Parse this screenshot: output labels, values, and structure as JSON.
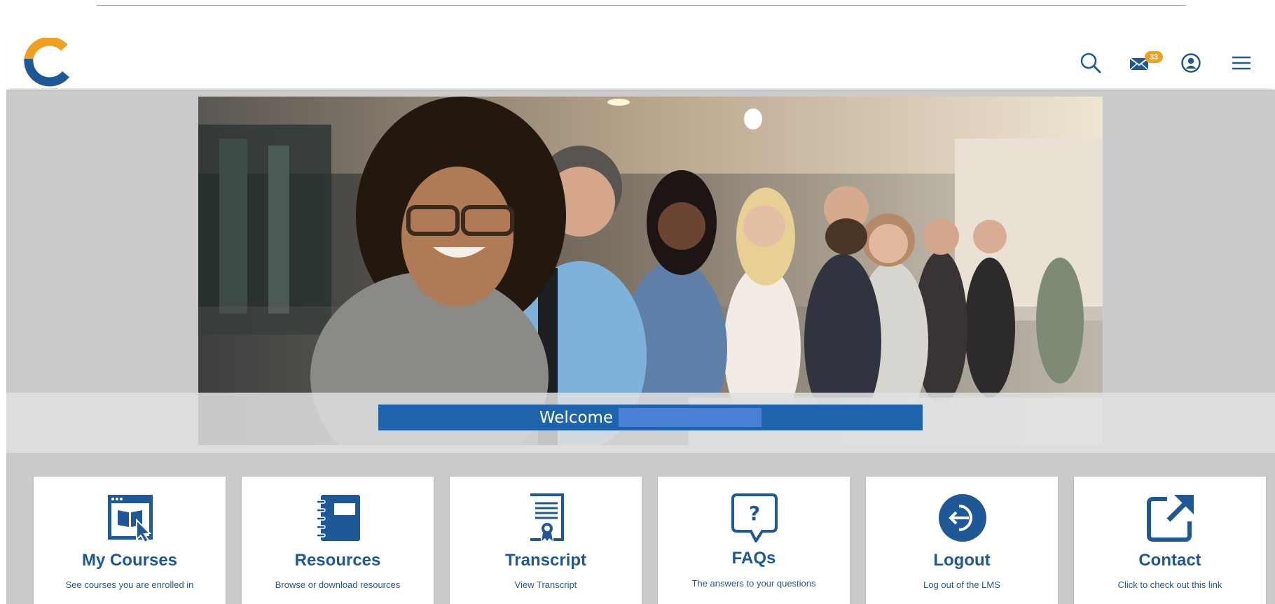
{
  "header": {
    "logo_name": "c-logo",
    "search_icon": "search-icon",
    "mail_icon": "mail-icon",
    "mail_badge": "33",
    "user_icon": "user-circle-icon",
    "menu_icon": "hamburger-menu-icon"
  },
  "hero": {
    "image": "group of smiling business people photo",
    "welcome": "Welcome"
  },
  "tiles": [
    {
      "title": "My Courses",
      "subtitle": "See courses you are enrolled in",
      "icon": "courses-icon"
    },
    {
      "title": "Resources",
      "subtitle": "Browse or download resources",
      "icon": "notebook-icon"
    },
    {
      "title": "Transcript",
      "subtitle": "View Transcript",
      "icon": "certificate-icon"
    },
    {
      "title": "FAQs",
      "subtitle": "The answers to your questions",
      "icon": "question-bubble-icon"
    },
    {
      "title": "Logout",
      "subtitle": "Log out of the LMS",
      "icon": "logout-icon"
    },
    {
      "title": "Contact",
      "subtitle": "Click to check out this link",
      "icon": "external-link-icon"
    }
  ],
  "colors": {
    "brand_blue": "#1e63ac",
    "tile_text": "#1f5896",
    "logo_orange": "#f0a021",
    "stage_gray": "#cbcbcb"
  }
}
